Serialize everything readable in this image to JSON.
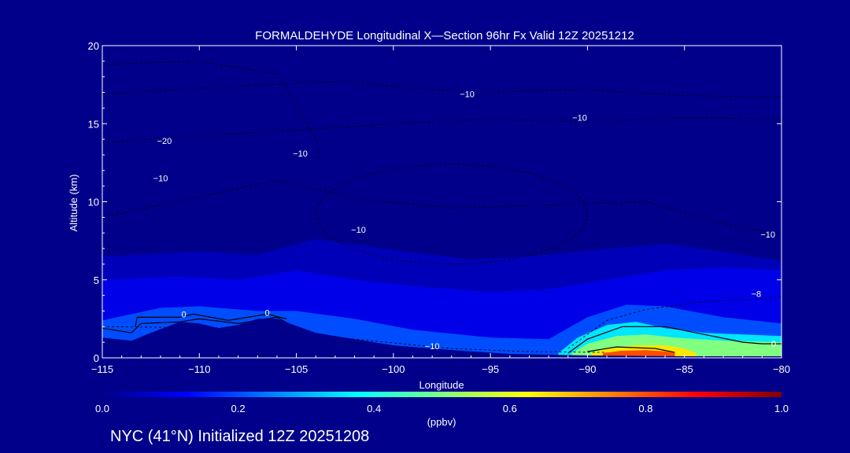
{
  "chart_data": {
    "type": "heatmap",
    "title": "FORMALDEHYDE Longitudinal X—Section 96hr  Fx Valid 12Z 20251212",
    "xlabel": "Longitude",
    "ylabel": "Altitude (km)",
    "xlim": [
      -115,
      -80
    ],
    "ylim": [
      0,
      20
    ],
    "x_ticks": [
      -115,
      -110,
      -105,
      -100,
      -95,
      -90,
      -85,
      -80
    ],
    "x_tick_labels": [
      "−115",
      "−110",
      "−105",
      "−100",
      "−95",
      "−90",
      "−85",
      "−80"
    ],
    "y_ticks": [
      0,
      5,
      10,
      15,
      20
    ],
    "y_tick_labels": [
      "0",
      "5",
      "10",
      "15",
      "20"
    ],
    "colorbar": {
      "label": "(ppbv)",
      "min": 0.0,
      "max": 1.0,
      "ticks": [
        0.0,
        0.2,
        0.4,
        0.6,
        0.8,
        1.0
      ],
      "tick_labels": [
        "0.0",
        "0.2",
        "0.4",
        "0.6",
        "0.8",
        "1.0"
      ],
      "colormap": [
        "#00008b",
        "#0000ff",
        "#0080ff",
        "#00ffff",
        "#80ff80",
        "#ffff00",
        "#ff8000",
        "#ff0000",
        "#800000"
      ]
    },
    "concentration_layers": [
      {
        "level": 0.05,
        "top": [
          [
            -115,
            6.5
          ],
          [
            -110,
            6.8
          ],
          [
            -107,
            6.6
          ],
          [
            -104,
            7.6
          ],
          [
            -100,
            6.9
          ],
          [
            -96,
            6.3
          ],
          [
            -92,
            6.6
          ],
          [
            -89,
            7.0
          ],
          [
            -86,
            7.3
          ],
          [
            -83,
            6.8
          ],
          [
            -80,
            6.2
          ]
        ]
      },
      {
        "level": 0.1,
        "top": [
          [
            -115,
            5.0
          ],
          [
            -111,
            5.2
          ],
          [
            -108,
            5.0
          ],
          [
            -105,
            5.6
          ],
          [
            -102,
            5.0
          ],
          [
            -99,
            4.6
          ],
          [
            -95,
            4.2
          ],
          [
            -92,
            4.4
          ],
          [
            -89,
            5.0
          ],
          [
            -86,
            5.6
          ],
          [
            -83,
            5.8
          ],
          [
            -80,
            5.6
          ]
        ]
      },
      {
        "level": 0.2,
        "top": [
          [
            -115,
            2.4
          ],
          [
            -112,
            3.2
          ],
          [
            -110,
            3.3
          ],
          [
            -107,
            3.0
          ],
          [
            -105,
            3.0
          ],
          [
            -102,
            2.5
          ],
          [
            -99,
            1.8
          ],
          [
            -95,
            1.3
          ],
          [
            -92,
            1.2
          ],
          [
            -90,
            2.6
          ],
          [
            -88,
            3.4
          ],
          [
            -86,
            3.3
          ],
          [
            -83,
            2.6
          ],
          [
            -80,
            2.2
          ]
        ]
      },
      {
        "level": 0.35,
        "top": [
          [
            -91.5,
            0.3
          ],
          [
            -90.5,
            1.3
          ],
          [
            -89,
            2.1
          ],
          [
            -87.5,
            2.3
          ],
          [
            -86,
            1.9
          ],
          [
            -84,
            1.6
          ],
          [
            -80,
            1.4
          ]
        ]
      },
      {
        "level": 0.5,
        "top": [
          [
            -90.8,
            0.3
          ],
          [
            -90,
            0.9
          ],
          [
            -88.5,
            1.4
          ],
          [
            -87,
            1.5
          ],
          [
            -85.5,
            1.3
          ],
          [
            -83,
            1.1
          ],
          [
            -80,
            1.0
          ]
        ]
      },
      {
        "level": 0.65,
        "top": [
          [
            -89.8,
            0.3
          ],
          [
            -89,
            0.6
          ],
          [
            -87.5,
            0.8
          ],
          [
            -86,
            0.8
          ],
          [
            -85,
            0.6
          ],
          [
            -84.4,
            0.3
          ]
        ]
      },
      {
        "level": 0.8,
        "top": [
          [
            -89.2,
            0.3
          ],
          [
            -88.3,
            0.45
          ],
          [
            -87,
            0.5
          ],
          [
            -86,
            0.42
          ],
          [
            -85.5,
            0.3
          ]
        ]
      }
    ],
    "contour_labels": [
      {
        "text": "0",
        "lon": -110.8,
        "alt": 2.6
      },
      {
        "text": "0",
        "lon": -106.5,
        "alt": 2.7
      },
      {
        "text": "0",
        "lon": -80.4,
        "alt": 0.7
      },
      {
        "text": "−10",
        "lon": -98,
        "alt": 0.55
      },
      {
        "text": "−10",
        "lon": -112,
        "alt": 11.3
      },
      {
        "text": "−10",
        "lon": -104.8,
        "alt": 12.9
      },
      {
        "text": "−10",
        "lon": -101.8,
        "alt": 8.0
      },
      {
        "text": "−10",
        "lon": -96.2,
        "alt": 16.7
      },
      {
        "text": "−10",
        "lon": -90.4,
        "alt": 15.2
      },
      {
        "text": "−10",
        "lon": -80.7,
        "alt": 7.7
      },
      {
        "text": "−8",
        "lon": -81.3,
        "alt": 3.9
      },
      {
        "text": "−20",
        "lon": -111.8,
        "alt": 13.7
      }
    ]
  },
  "footer": {
    "caption": "NYC (41°N) Initialized 12Z 20251208"
  },
  "colors": {
    "background": "#00008b",
    "text": "#ffffff",
    "terrain": "#00008b",
    "contour": "#000000"
  }
}
